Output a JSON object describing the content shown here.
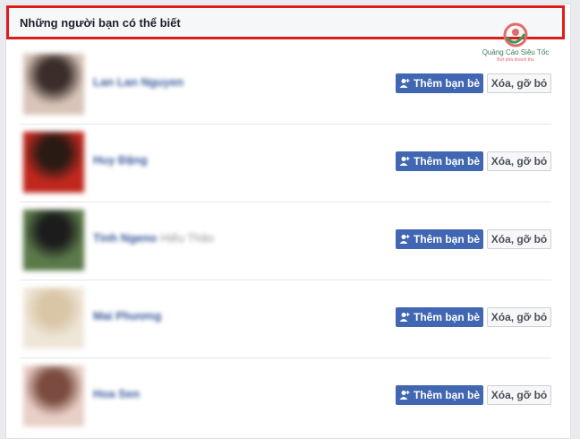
{
  "header": {
    "title": "Những người bạn có thể biết"
  },
  "watermark": {
    "brand": "Quảng Cáo Siêu Tốc",
    "tagline": "Bứt phá doanh thu"
  },
  "buttons": {
    "add_label": "Thêm bạn bè",
    "remove_label": "Xóa, gỡ bỏ"
  },
  "colors": {
    "accent": "#4267b2",
    "highlight_border": "#e01b1b",
    "name_link": "#365899"
  },
  "suggestions": [
    {
      "name": "Lan Lan Nguyen",
      "mutual": "",
      "avatar_colors": [
        "#d8c4b8",
        "#3a2d2a"
      ]
    },
    {
      "name": "Huy Đặng",
      "mutual": "",
      "avatar_colors": [
        "#c0281e",
        "#2a1a14"
      ]
    },
    {
      "name": "Tinh Ngeno",
      "mutual": "Hiếu Thảo",
      "avatar_colors": [
        "#5b7a4a",
        "#1c1c1c"
      ]
    },
    {
      "name": "Mai Phương",
      "mutual": "",
      "avatar_colors": [
        "#efe6d8",
        "#d9c6a6"
      ]
    },
    {
      "name": "Hoa Sen",
      "mutual": "",
      "avatar_colors": [
        "#e8cfc7",
        "#7a4b3e"
      ]
    }
  ]
}
